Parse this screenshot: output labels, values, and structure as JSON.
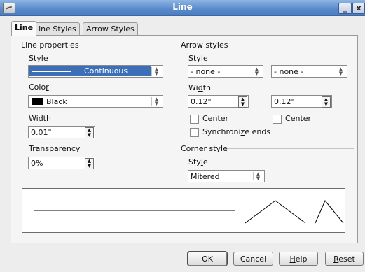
{
  "window": {
    "title": "Line",
    "min_label": "_",
    "close_label": "x"
  },
  "tabs": [
    {
      "label": "Line",
      "active": true
    },
    {
      "label": "Line Styles",
      "active": false
    },
    {
      "label": "Arrow Styles",
      "active": false
    }
  ],
  "line_properties": {
    "section_title": "Line properties",
    "style": {
      "label_u": "S",
      "label_rest": "tyle",
      "value": "Continuous"
    },
    "color": {
      "label_pre": "Colo",
      "label_u": "r",
      "value": "Black",
      "swatch_color": "#000000"
    },
    "width": {
      "label_u": "W",
      "label_rest": "idth",
      "value": "0.01\""
    },
    "transparency": {
      "label_u": "T",
      "label_rest": "ransparency",
      "value": "0%"
    }
  },
  "arrow_styles": {
    "section_title": "Arrow styles",
    "style": {
      "label_pre": "St",
      "label_u": "y",
      "label_rest": "le",
      "start_value": "- none -",
      "end_value": "- none -"
    },
    "width": {
      "label_pre": "Wi",
      "label_u": "d",
      "label_rest": "th",
      "start_value": "0.12\"",
      "end_value": "0.12\""
    },
    "center_start": {
      "label_pre": "Ce",
      "label_u": "n",
      "label_rest": "ter",
      "checked": false
    },
    "center_end": {
      "label_pre": "C",
      "label_u": "e",
      "label_rest": "nter",
      "checked": false
    },
    "synchronize": {
      "label_pre": "Synchroni",
      "label_u": "z",
      "label_rest": "e ends",
      "checked": false
    }
  },
  "corner_style": {
    "section_title": "Corner style",
    "style": {
      "label_pre": "Sty",
      "label_u": "l",
      "label_rest": "e",
      "value": "Mitered"
    }
  },
  "buttons": {
    "ok": "OK",
    "cancel": "Cancel",
    "help_u": "H",
    "help_rest": "elp",
    "reset_u": "R",
    "reset_rest": "eset"
  }
}
